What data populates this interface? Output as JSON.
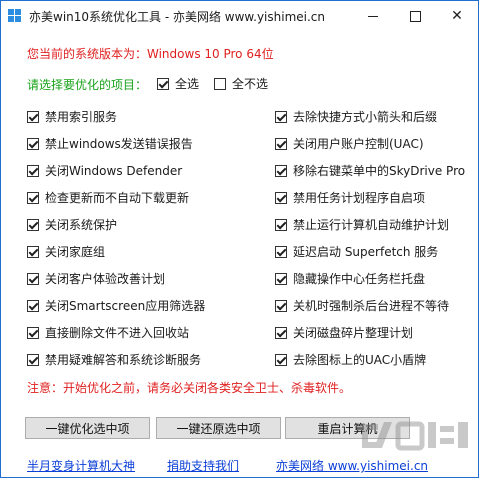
{
  "window": {
    "title": "亦美win10系统优化工具 - 亦美网络 www.yishimei.cn"
  },
  "version_line": "您当前的系统版本为：Windows 10 Pro  64位",
  "select_prompt": "请选择要优化的项目：",
  "select_all": {
    "label": "全选",
    "checked": true
  },
  "select_none": {
    "label": "全不选",
    "checked": false
  },
  "left_items": [
    {
      "label": "禁用索引服务",
      "checked": true
    },
    {
      "label": "禁止windows发送错误报告",
      "checked": true
    },
    {
      "label": "关闭Windows Defender",
      "checked": true
    },
    {
      "label": "检查更新而不自动下载更新",
      "checked": true
    },
    {
      "label": "关闭系统保护",
      "checked": true
    },
    {
      "label": "关闭家庭组",
      "checked": true
    },
    {
      "label": "关闭客户体验改善计划",
      "checked": true
    },
    {
      "label": "关闭Smartscreen应用筛选器",
      "checked": true
    },
    {
      "label": "直接删除文件不进入回收站",
      "checked": true
    },
    {
      "label": "禁用疑难解答和系统诊断服务",
      "checked": true
    }
  ],
  "right_items": [
    {
      "label": "去除快捷方式小箭头和后缀",
      "checked": true
    },
    {
      "label": "关闭用户账户控制(UAC)",
      "checked": true
    },
    {
      "label": "移除右键菜单中的SkyDrive Pro",
      "checked": true
    },
    {
      "label": "禁用任务计划程序自启项",
      "checked": true
    },
    {
      "label": "禁止运行计算机自动维护计划",
      "checked": true
    },
    {
      "label": "延迟启动 Superfetch 服务",
      "checked": true
    },
    {
      "label": "隐藏操作中心任务栏托盘",
      "checked": true
    },
    {
      "label": "关机时强制杀后台进程不等待",
      "checked": true
    },
    {
      "label": "关闭磁盘碎片整理计划",
      "checked": true
    },
    {
      "label": "去除图标上的UAC小盾牌",
      "checked": true
    }
  ],
  "notice": "注意：开始优化之前，请务必关闭各类安全卫士、杀毒软件。",
  "buttons": {
    "optimize": "一键优化选中项",
    "restore": "一键还原选中项",
    "restart": "重启计算机"
  },
  "links": {
    "link1": "半月变身计算机大神",
    "link2": "捐助支持我们",
    "link3": "亦美网络 www.yishimei.cn"
  },
  "colors": {
    "warning_text": "#e02020",
    "prompt_text": "#1aa31a",
    "link_text": "#0b3fd6"
  }
}
